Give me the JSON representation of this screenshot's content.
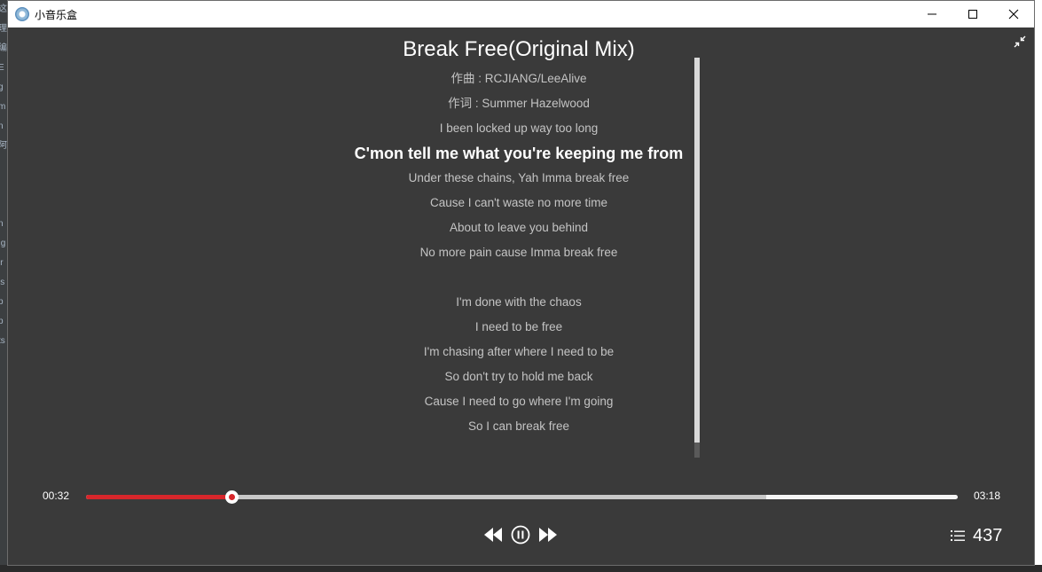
{
  "app": {
    "title": "小音乐盒"
  },
  "background_app": {
    "left_fragments": [
      "这",
      "理",
      "编",
      "E",
      "g",
      "m",
      "n",
      "阿",
      "",
      "",
      "",
      "n",
      ".g",
      "ir",
      "js",
      "p",
      "p",
      "ts"
    ]
  },
  "song": {
    "title": "Break Free(Original Mix)",
    "composer_line": "作曲 : RCJIANG/LeeAlive",
    "lyricist_line": "作词 : Summer Hazelwood"
  },
  "lyrics": {
    "lines": [
      "I been locked up way too long",
      "C'mon tell me what you're keeping me from",
      "Under these chains, Yah Imma break free",
      "Cause I can't waste no more time",
      "About to leave you behind",
      "No more pain cause Imma break free",
      "",
      "I'm done with the chaos",
      "I need to be free",
      "I'm chasing after where I need to be",
      "So don't try to hold me back",
      "Cause I need to go where I'm going",
      "So I can break free"
    ],
    "current_index": 1
  },
  "player": {
    "current_time": "00:32",
    "total_time": "03:18",
    "progress_fraction": 0.167,
    "buffered_fraction": 0.78,
    "state": "playing",
    "playlist_count": "437"
  },
  "colors": {
    "background": "#3a3a3a",
    "accent": "#d7262b",
    "text": "#ffffff",
    "lyric_text": "#c4c4c4"
  },
  "icons": {
    "app": "music-box-icon",
    "minimize": "minimize-icon",
    "maximize": "maximize-icon",
    "close": "close-icon",
    "collapse": "collapse-icon",
    "previous": "previous-icon",
    "pause": "pause-icon",
    "next": "next-icon",
    "playlist": "playlist-icon"
  }
}
